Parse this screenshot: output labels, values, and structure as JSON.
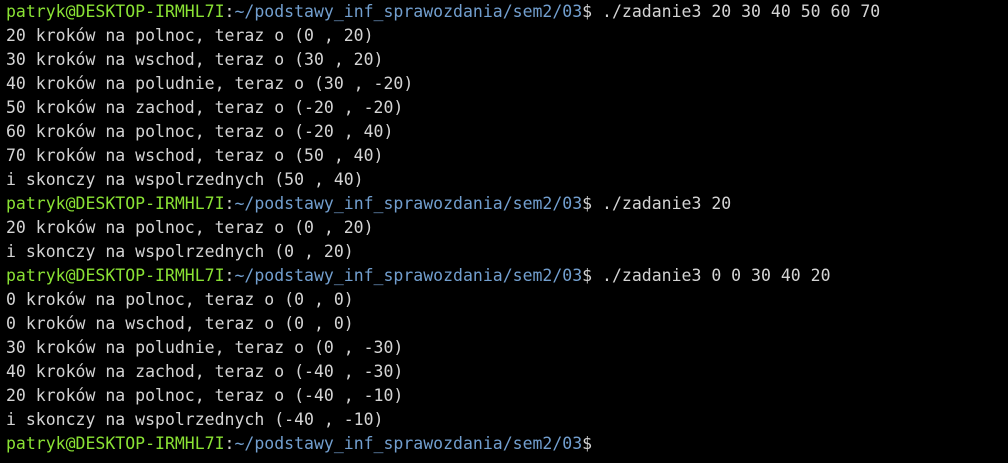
{
  "terminal": {
    "colors": {
      "background": "#000000",
      "text": "#d4d4d4",
      "prompt_user": "#8ae234",
      "prompt_path": "#729fcf"
    },
    "lines": [
      {
        "kind": "prompt",
        "user": "patryk@DESKTOP-IRMHL7I",
        "sep": ":",
        "path": "~/podstawy_inf_sprawozdania/sem2/03",
        "sign": "$ ",
        "command": "./zadanie3 20 30 40 50 60 70"
      },
      {
        "kind": "output",
        "text": "20 kroków na polnoc, teraz o (0 , 20)"
      },
      {
        "kind": "output",
        "text": "30 kroków na wschod, teraz o (30 , 20)"
      },
      {
        "kind": "output",
        "text": "40 kroków na poludnie, teraz o (30 , -20)"
      },
      {
        "kind": "output",
        "text": "50 kroków na zachod, teraz o (-20 , -20)"
      },
      {
        "kind": "output",
        "text": "60 kroków na polnoc, teraz o (-20 , 40)"
      },
      {
        "kind": "output",
        "text": "70 kroków na wschod, teraz o (50 , 40)"
      },
      {
        "kind": "output",
        "text": "i skonczy na wspolrzednych (50 , 40)"
      },
      {
        "kind": "prompt",
        "user": "patryk@DESKTOP-IRMHL7I",
        "sep": ":",
        "path": "~/podstawy_inf_sprawozdania/sem2/03",
        "sign": "$ ",
        "command": "./zadanie3 20"
      },
      {
        "kind": "output",
        "text": "20 kroków na polnoc, teraz o (0 , 20)"
      },
      {
        "kind": "output",
        "text": "i skonczy na wspolrzednych (0 , 20)"
      },
      {
        "kind": "prompt",
        "user": "patryk@DESKTOP-IRMHL7I",
        "sep": ":",
        "path": "~/podstawy_inf_sprawozdania/sem2/03",
        "sign": "$ ",
        "command": "./zadanie3 0 0 30 40 20"
      },
      {
        "kind": "output",
        "text": "0 kroków na polnoc, teraz o (0 , 0)"
      },
      {
        "kind": "output",
        "text": "0 kroków na wschod, teraz o (0 , 0)"
      },
      {
        "kind": "output",
        "text": "30 kroków na poludnie, teraz o (0 , -30)"
      },
      {
        "kind": "output",
        "text": "40 kroków na zachod, teraz o (-40 , -30)"
      },
      {
        "kind": "output",
        "text": "20 kroków na polnoc, teraz o (-40 , -10)"
      },
      {
        "kind": "output",
        "text": "i skonczy na wspolrzednych (-40 , -10)"
      },
      {
        "kind": "prompt",
        "user": "patryk@DESKTOP-IRMHL7I",
        "sep": ":",
        "path": "~/podstawy_inf_sprawozdania/sem2/03",
        "sign": "$",
        "command": ""
      }
    ]
  }
}
